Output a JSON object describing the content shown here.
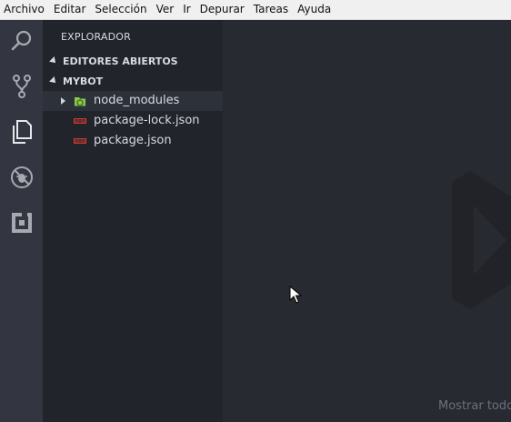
{
  "menu": {
    "items": [
      "Archivo",
      "Editar",
      "Selección",
      "Ver",
      "Ir",
      "Depurar",
      "Tareas",
      "Ayuda"
    ]
  },
  "activity_bar": {
    "icons": [
      "search-icon",
      "source-control-icon",
      "files-icon",
      "debug-icon",
      "extensions-icon"
    ]
  },
  "sidebar": {
    "title": "EXPLORADOR",
    "open_editors_label": "EDITORES ABIERTOS",
    "project_label": "MYBOT",
    "files": [
      {
        "name": "node_modules",
        "type": "folder",
        "icon": "node-folder-icon"
      },
      {
        "name": "package-lock.json",
        "type": "file",
        "icon": "npm-icon"
      },
      {
        "name": "package.json",
        "type": "file",
        "icon": "npm-icon"
      }
    ]
  },
  "editor": {
    "show_all_text": "Mostrar todo"
  },
  "colors": {
    "menubar_bg": "#f0f0f0",
    "activity_bg": "#333641",
    "sidebar_bg": "#21252b",
    "editor_bg": "#282a31",
    "npm_red": "#cb3837",
    "node_green": "#8cc84b"
  }
}
